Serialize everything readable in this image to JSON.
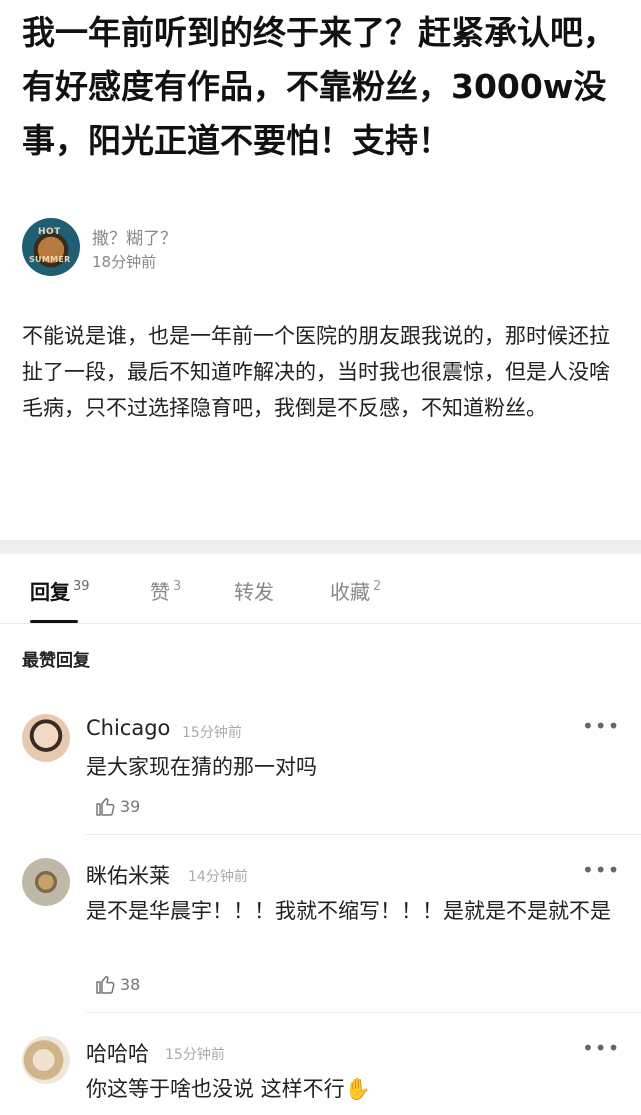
{
  "post": {
    "title": "我一年前听到的终于来了？赶紧承认吧，有好感度有作品，不靠粉丝，3000w没事，阳光正道不要怕！支持！",
    "author_avatar_text_top": "HOT",
    "author_avatar_text_bottom": "SUMMER",
    "author_name": "撒？糊了？",
    "time": "18分钟前",
    "body": "不能说是谁，也是一年前一个医院的朋友跟我说的，那时候还拉扯了一段，最后不知道咋解决的，当时我也很震惊，但是人没啥毛病，只不过选择隐育吧，我倒是不反感，不知道粉丝。"
  },
  "tabs": [
    {
      "label": "回复",
      "count": "39"
    },
    {
      "label": "赞",
      "count": "3"
    },
    {
      "label": "转发",
      "count": ""
    },
    {
      "label": "收藏",
      "count": "2"
    }
  ],
  "section_label": "最赞回复",
  "comments": [
    {
      "name": "Chicago",
      "time": "15分钟前",
      "text": "是大家现在猜的那一对吗",
      "likes": "39",
      "more": "•••",
      "avatar_icon": "avatar"
    },
    {
      "name": "眯佑米莱",
      "time": "14分钟前",
      "text": "是不是华晨宇！！！我就不缩写！！！是就是不是就不是",
      "likes": "38",
      "more": "•••",
      "avatar_icon": "avatar"
    },
    {
      "name": "哈哈哈",
      "time": "15分钟前",
      "text": "你这等于啥也没说 这样不行✋",
      "likes": "",
      "more": "•••",
      "avatar_icon": "avatar"
    }
  ],
  "icons": {
    "like": "thumbs-up-icon",
    "more": "more-dots-icon"
  }
}
